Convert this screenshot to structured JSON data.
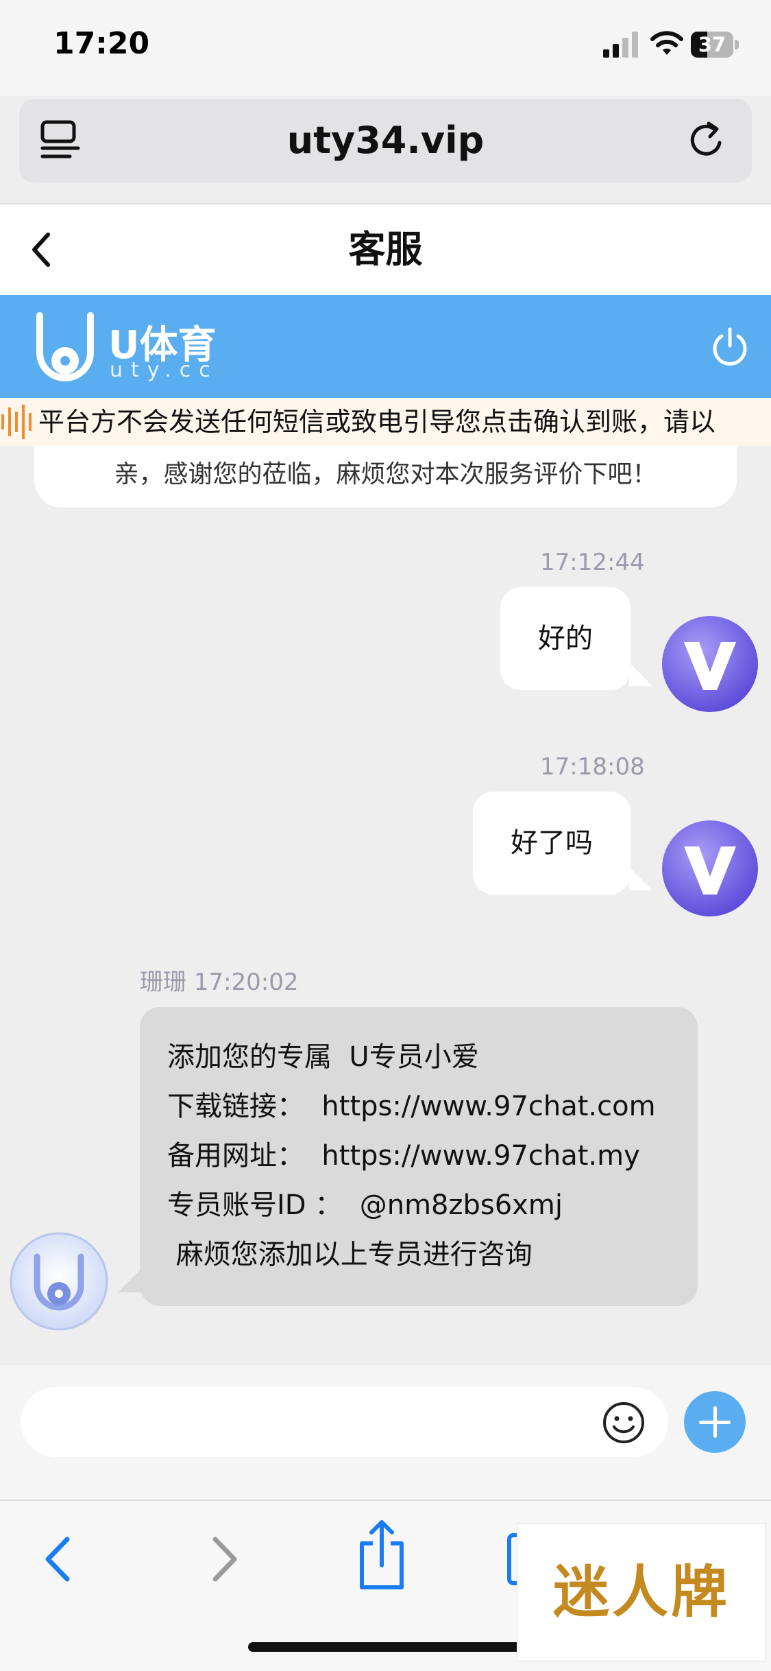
{
  "status_bar": {
    "time": "17:20",
    "battery": "37"
  },
  "browser": {
    "url": "uty34.vip"
  },
  "page": {
    "title": "客服"
  },
  "brand": {
    "name": "U体育",
    "domain": "uty.cc"
  },
  "notice": {
    "text": "平台方不会发送任何短信或致电引导您点击确认到账，请以"
  },
  "chat": {
    "system_message": "亲，感谢您的莅临，麻烦您对本次服务评价下吧！",
    "messages": [
      {
        "timestamp": "17:12:44",
        "text": "好的"
      },
      {
        "timestamp": "17:18:08",
        "text": "好了吗"
      }
    ],
    "agent": {
      "name": "珊珊",
      "timestamp": "17:20:02",
      "lines": [
        "添加您的专属  U专员小爱",
        "下载链接：  https://www.97chat.com",
        "备用网址：  https://www.97chat.my",
        "专员账号ID ：  @nm8zbs6xmj",
        " 麻烦您添加以上专员进行咨询"
      ]
    }
  },
  "input": {
    "placeholder": ""
  },
  "watermark": {
    "text": "迷人牌"
  },
  "colors": {
    "accent": "#5aaef0",
    "ios_blue": "#1a7cf5"
  }
}
